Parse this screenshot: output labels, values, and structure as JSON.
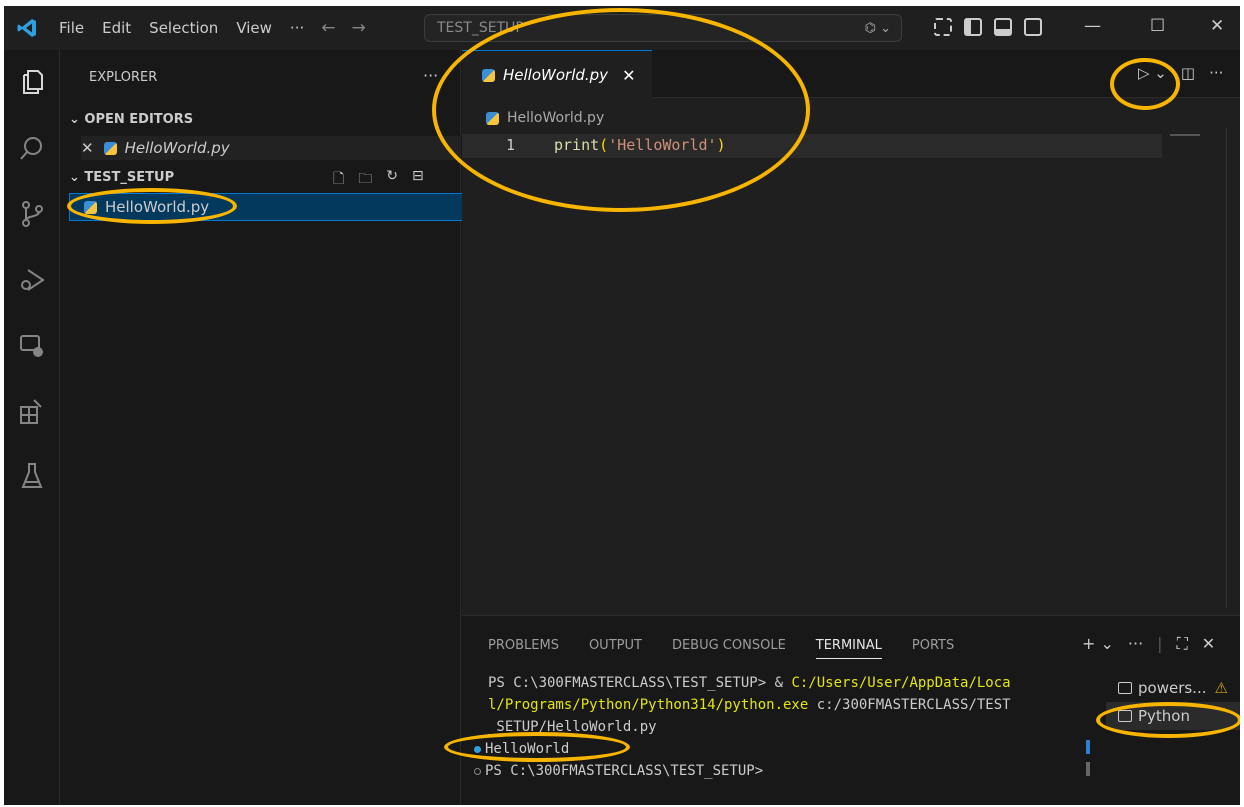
{
  "titlebar": {
    "menu": [
      "File",
      "Edit",
      "Selection",
      "View",
      "···"
    ],
    "search_text": "TEST_SETUP",
    "controls": {
      "minimize": "—",
      "maximize": "☐",
      "close": "✕"
    }
  },
  "explorer": {
    "title": "EXPLORER",
    "more": "···",
    "open_editors_label": "OPEN EDITORS",
    "open_editor_file": "HelloWorld.py",
    "folder_label": "TEST_SETUP",
    "files": [
      "HelloWorld.py"
    ]
  },
  "editor": {
    "tab_label": "HelloWorld.py",
    "breadcrumb": "HelloWorld.py",
    "line_number": "1",
    "code": {
      "fn": "print",
      "open": "(",
      "str": "'HelloWorld'",
      "close": ")"
    }
  },
  "panel": {
    "tabs": [
      "PROBLEMS",
      "OUTPUT",
      "DEBUG CONSOLE",
      "TERMINAL",
      "PORTS"
    ],
    "active_tab": "TERMINAL",
    "terminal_lines": {
      "prompt1": "PS C:\\300FMASTERCLASS\\TEST_SETUP> & ",
      "exe_path_a": "C:/Users/User/AppData/Loca",
      "exe_path_b": "l/Programs/Python/Python314/python.exe",
      "arg_a": " c:/300FMASTERCLASS/TEST",
      "arg_b": "_SETUP/HelloWorld.py",
      "output": "HelloWorld",
      "prompt2": "PS C:\\300FMASTERCLASS\\TEST_SETUP>"
    },
    "terminals": [
      "powers...",
      "Python"
    ]
  },
  "colors": {
    "accent": "#0078d4",
    "annotation": "#f7b500"
  }
}
